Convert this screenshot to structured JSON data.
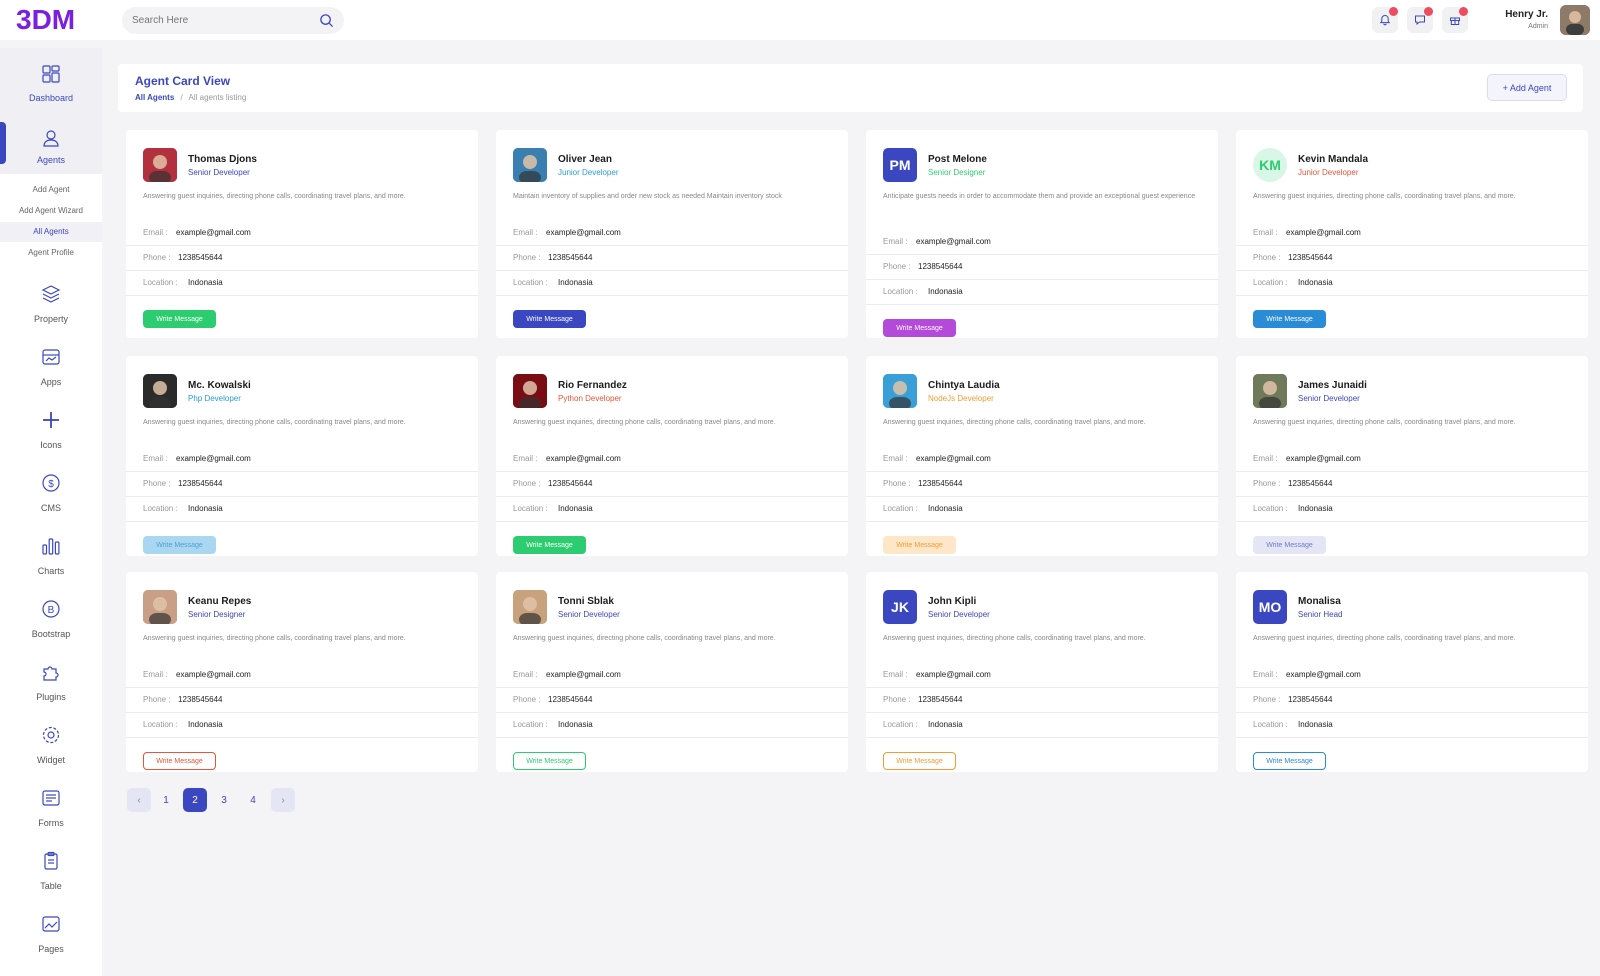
{
  "header": {
    "logo": "3DM",
    "search_placeholder": "Search Here",
    "user_name": "Henry Jr.",
    "user_role": "Admin"
  },
  "sidebar": {
    "items": [
      {
        "label": "Dashboard",
        "icon": "dashboard-icon"
      },
      {
        "label": "Agents",
        "icon": "user-icon"
      },
      {
        "label": "Property",
        "icon": "layers-icon"
      },
      {
        "label": "Apps",
        "icon": "apps-icon"
      },
      {
        "label": "Icons",
        "icon": "plus-icon"
      },
      {
        "label": "CMS",
        "icon": "dollar-icon"
      },
      {
        "label": "Charts",
        "icon": "bar-chart-icon"
      },
      {
        "label": "Bootstrap",
        "icon": "bootstrap-icon"
      },
      {
        "label": "Plugins",
        "icon": "puzzle-icon"
      },
      {
        "label": "Widget",
        "icon": "gear-icon"
      },
      {
        "label": "Forms",
        "icon": "form-icon"
      },
      {
        "label": "Table",
        "icon": "clipboard-icon"
      },
      {
        "label": "Pages",
        "icon": "image-icon"
      }
    ],
    "agents_submenu": [
      "Add Agent",
      "Add Agent Wizard",
      "All Agents",
      "Agent Profile"
    ]
  },
  "page": {
    "title": "Agent Card View",
    "breadcrumb_1": "All Agents",
    "breadcrumb_sep": "/",
    "breadcrumb_2": "All agents listing",
    "add_button": "+ Add Agent"
  },
  "labels": {
    "email": "Email :",
    "phone": "Phone :",
    "location": "Location :",
    "write_message": "Write Message"
  },
  "agents": [
    {
      "name": "Thomas Djons",
      "role": "Senior Developer",
      "role_color": "#3b47c0",
      "desc": "Answering guest inquiries, directing phone calls, coordinating travel plans, and more.",
      "email": "example@gmail.com",
      "phone": "1238545644",
      "location": "Indonasia",
      "initials": "",
      "avatar_color": "#b3303f",
      "btn_style": "solid",
      "btn_color": "#2ecc71"
    },
    {
      "name": "Oliver Jean",
      "role": "Junior Developer",
      "role_color": "#2a9bd6",
      "desc": "Maintain inventory of supplies and order new stock as needed Maintain inventory stock",
      "email": "example@gmail.com",
      "phone": "1238545644",
      "location": "Indonasia",
      "initials": "",
      "avatar_color": "#3a7fb0",
      "btn_style": "solid",
      "btn_color": "#3b47c0"
    },
    {
      "name": "Post Melone",
      "role": "Senior Designer",
      "role_color": "#2ecc71",
      "desc": "Anticipate guests needs in order to accommodate them and provide an exceptional guest experience",
      "email": "example@gmail.com",
      "phone": "1238545644",
      "location": "Indonasia",
      "initials": "PM",
      "avatar_color": "#3b47c0",
      "btn_style": "solid",
      "btn_color": "#b34ad9"
    },
    {
      "name": "Kevin Mandala",
      "role": "Junior Developer",
      "role_color": "#e8553a",
      "desc": "Answering guest inquiries, directing phone calls, coordinating travel plans, and more.",
      "email": "example@gmail.com",
      "phone": "1238545644",
      "location": "Indonasia",
      "initials": "KM",
      "avatar_color": "#d9f7e6",
      "btn_style": "solid",
      "btn_color": "#2a8bd6"
    },
    {
      "name": "Mc. Kowalski",
      "role": "Php Developer",
      "role_color": "#2a9bd6",
      "desc": "Answering guest inquiries, directing phone calls, coordinating travel plans, and more.",
      "email": "example@gmail.com",
      "phone": "1238545644",
      "location": "Indonasia",
      "initials": "",
      "avatar_color": "#2b2b2b",
      "btn_style": "light",
      "btn_color": "#a9d7f2"
    },
    {
      "name": "Rio Fernandez",
      "role": "Python Developer",
      "role_color": "#e8553a",
      "desc": "Answering guest inquiries, directing phone calls, coordinating travel plans, and more.",
      "email": "example@gmail.com",
      "phone": "1238545644",
      "location": "Indonasia",
      "initials": "",
      "avatar_color": "#7a0d14",
      "btn_style": "solid",
      "btn_color": "#2ecc71"
    },
    {
      "name": "Chintya Laudia",
      "role": "NodeJs Developer",
      "role_color": "#f39c33",
      "desc": "Answering guest inquiries, directing phone calls, coordinating travel plans, and more.",
      "email": "example@gmail.com",
      "phone": "1238545644",
      "location": "Indonasia",
      "initials": "",
      "avatar_color": "#3a9fd6",
      "btn_style": "light",
      "btn_color": "#fde7c8"
    },
    {
      "name": "James Junaidi",
      "role": "Senior Developer",
      "role_color": "#3b47c0",
      "desc": "Answering guest inquiries, directing phone calls, coordinating travel plans, and more.",
      "email": "example@gmail.com",
      "phone": "1238545644",
      "location": "Indonasia",
      "initials": "",
      "avatar_color": "#6f7a5a",
      "btn_style": "light",
      "btn_color": "#e4e6f5"
    },
    {
      "name": "Keanu Repes",
      "role": "Senior Designer",
      "role_color": "#3b47c0",
      "desc": "Answering guest inquiries, directing phone calls, coordinating travel plans, and more.",
      "email": "example@gmail.com",
      "phone": "1238545644",
      "location": "Indonasia",
      "initials": "",
      "avatar_color": "#c99f86",
      "btn_style": "outline",
      "btn_color": "#e8553a"
    },
    {
      "name": "Tonni Sblak",
      "role": "Senior Developer",
      "role_color": "#3b47c0",
      "desc": "Answering guest inquiries, directing phone calls, coordinating travel plans, and more.",
      "email": "example@gmail.com",
      "phone": "1238545644",
      "location": "Indonasia",
      "initials": "",
      "avatar_color": "#c8a27d",
      "btn_style": "outline",
      "btn_color": "#2ecc71"
    },
    {
      "name": "John Kipli",
      "role": "Senior Developer",
      "role_color": "#3b47c0",
      "desc": "Answering guest inquiries, directing phone calls, coordinating travel plans, and more.",
      "email": "example@gmail.com",
      "phone": "1238545644",
      "location": "Indonasia",
      "initials": "JK",
      "avatar_color": "#3b47c0",
      "btn_style": "outline",
      "btn_color": "#f39c33"
    },
    {
      "name": "Monalisa",
      "role": "Senior Head",
      "role_color": "#3b47c0",
      "desc": "Answering guest inquiries, directing phone calls, coordinating travel plans, and more.",
      "email": "example@gmail.com",
      "phone": "1238545644",
      "location": "Indonasia",
      "initials": "MO",
      "avatar_color": "#3b47c0",
      "btn_style": "outline",
      "btn_color": "#2a8bd6"
    }
  ],
  "pagination": {
    "prev": "‹",
    "next": "›",
    "pages": [
      "1",
      "2",
      "3",
      "4"
    ],
    "current": "2"
  }
}
